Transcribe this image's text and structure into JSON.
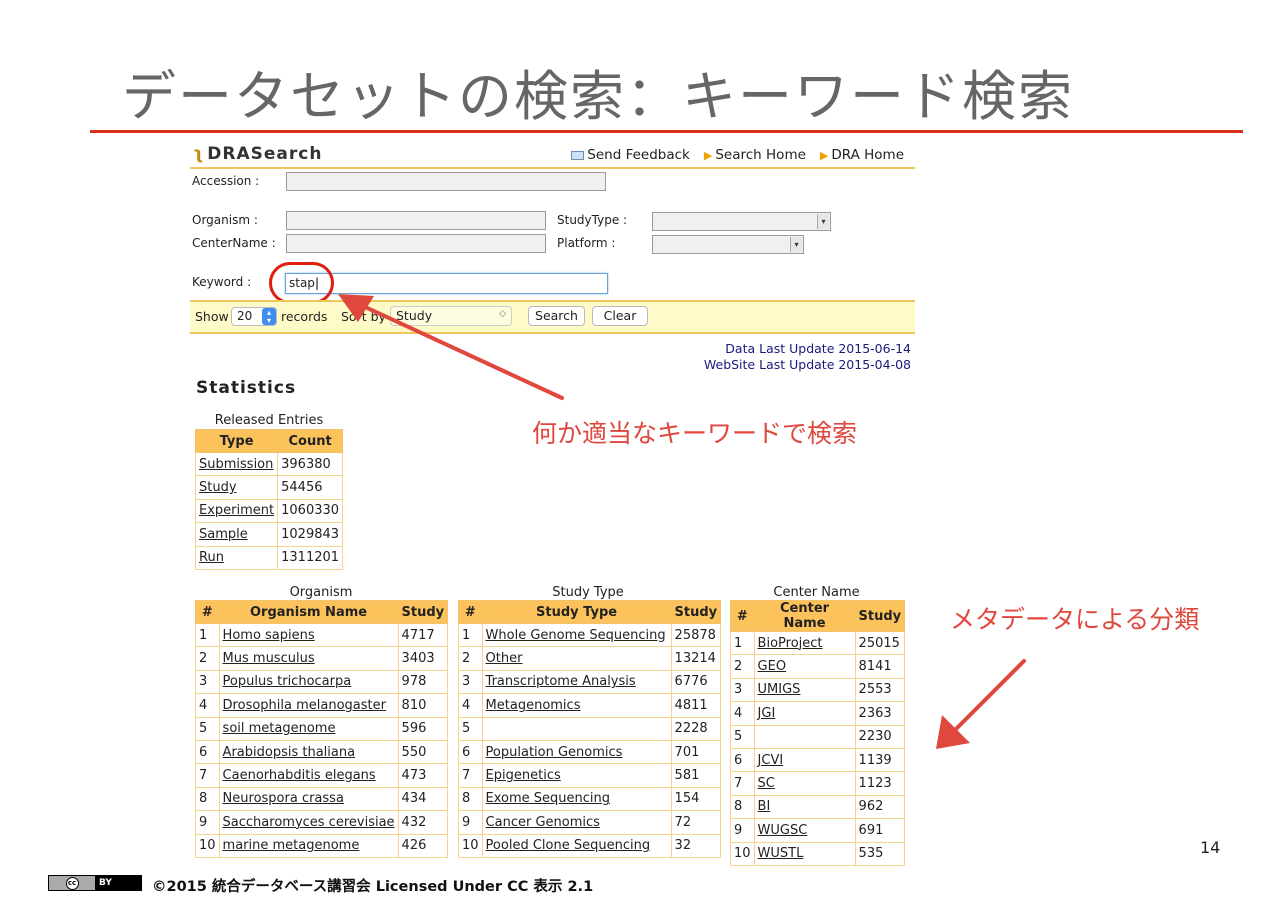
{
  "slide": {
    "title": "データセットの検索：キーワード検索",
    "page_number": "14",
    "footer": "©2015 統合データベース講習会 Licensed Under CC 表示 2.1",
    "cc_badge_left": "cc",
    "cc_badge_right": "BY",
    "annotation_keyword": "何か適当なキーワードで検索",
    "annotation_metadata": "メタデータによる分類",
    "accent_color": "#e0473d"
  },
  "header": {
    "logo_text": "DRASearch",
    "logo_icon": "dna-icon",
    "links": [
      {
        "label": "Send Feedback",
        "icon": "mail-icon"
      },
      {
        "label": "Search Home",
        "icon": "triangle-right-icon"
      },
      {
        "label": "DRA Home",
        "icon": "triangle-right-icon"
      }
    ]
  },
  "form": {
    "accession_label": "Accession :",
    "organism_label": "Organism :",
    "centername_label": "CenterName :",
    "studytype_label": "StudyType :",
    "platform_label": "Platform :",
    "keyword_label": "Keyword :",
    "keyword_value": "stap"
  },
  "toolbar": {
    "show_label": "Show",
    "records_value": "20",
    "records_label": "records",
    "sortby_label": "Sort by",
    "sort_value": "Study",
    "search_button": "Search",
    "clear_button": "Clear"
  },
  "updates": {
    "data_last_update": "Data Last Update 2015-06-14",
    "website_last_update": "WebSite Last Update 2015-04-08"
  },
  "statistics": {
    "heading": "Statistics",
    "released": {
      "caption": "Released Entries",
      "headers": [
        "Type",
        "Count"
      ],
      "rows": [
        [
          "Submission",
          "396380"
        ],
        [
          "Study",
          "54456"
        ],
        [
          "Experiment",
          "1060330"
        ],
        [
          "Sample",
          "1029843"
        ],
        [
          "Run",
          "1311201"
        ]
      ]
    },
    "organism": {
      "caption": "Organism",
      "headers": [
        "#",
        "Organism Name",
        "Study"
      ],
      "rows": [
        [
          "1",
          "Homo sapiens",
          "4717"
        ],
        [
          "2",
          "Mus musculus",
          "3403"
        ],
        [
          "3",
          "Populus trichocarpa",
          "978"
        ],
        [
          "4",
          "Drosophila melanogaster",
          "810"
        ],
        [
          "5",
          "soil metagenome",
          "596"
        ],
        [
          "6",
          "Arabidopsis thaliana",
          "550"
        ],
        [
          "7",
          "Caenorhabditis elegans",
          "473"
        ],
        [
          "8",
          "Neurospora crassa",
          "434"
        ],
        [
          "9",
          "Saccharomyces cerevisiae",
          "432"
        ],
        [
          "10",
          "marine metagenome",
          "426"
        ]
      ]
    },
    "study_type": {
      "caption": "Study Type",
      "headers": [
        "#",
        "Study Type",
        "Study"
      ],
      "rows": [
        [
          "1",
          "Whole Genome Sequencing",
          "25878"
        ],
        [
          "2",
          "Other",
          "13214"
        ],
        [
          "3",
          "Transcriptome Analysis",
          "6776"
        ],
        [
          "4",
          "Metagenomics",
          "4811"
        ],
        [
          "5",
          "",
          "2228"
        ],
        [
          "6",
          "Population Genomics",
          "701"
        ],
        [
          "7",
          "Epigenetics",
          "581"
        ],
        [
          "8",
          "Exome Sequencing",
          "154"
        ],
        [
          "9",
          "Cancer Genomics",
          "72"
        ],
        [
          "10",
          "Pooled Clone Sequencing",
          "32"
        ]
      ]
    },
    "center": {
      "caption": "Center Name",
      "headers": [
        "#",
        "Center Name",
        "Study"
      ],
      "rows": [
        [
          "1",
          "BioProject",
          "25015"
        ],
        [
          "2",
          "GEO",
          "8141"
        ],
        [
          "3",
          "UMIGS",
          "2553"
        ],
        [
          "4",
          "JGI",
          "2363"
        ],
        [
          "5",
          "",
          "2230"
        ],
        [
          "6",
          "JCVI",
          "1139"
        ],
        [
          "7",
          "SC",
          "1123"
        ],
        [
          "8",
          "BI",
          "962"
        ],
        [
          "9",
          "WUGSC",
          "691"
        ],
        [
          "10",
          "WUSTL",
          "535"
        ]
      ]
    }
  }
}
